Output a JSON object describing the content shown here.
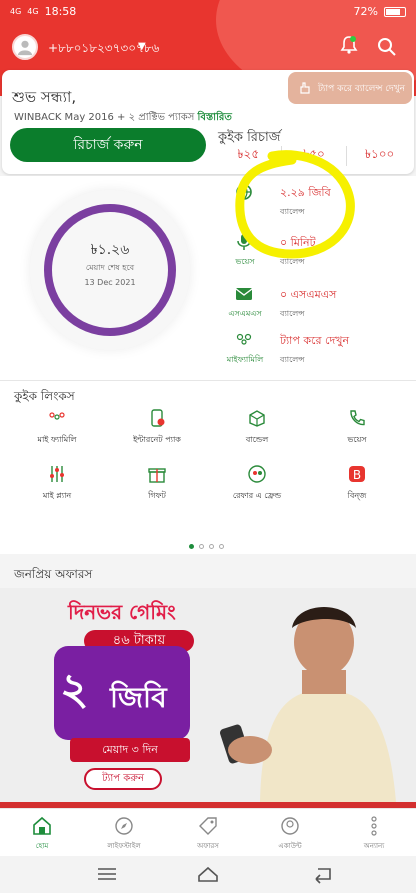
{
  "status_bar": {
    "network1": "4G",
    "network2": "4G",
    "time": "18:58",
    "battery": "72%"
  },
  "header": {
    "phone": "+৮৮০১৮২৩৭৩০৭৮৬"
  },
  "greeting": {
    "text": "শুভ সন্ধ্যা,",
    "pack": "WINBACK May 2016 + ২ প্রাক্টিভ প্যাকস",
    "details_link": "বিস্তারিত",
    "recharge_button": "রিচার্জ করুন",
    "tap_badge": "ট্যাপ করে ব্যালেন্স দেখুন"
  },
  "quick_recharge": {
    "title": "কুইক রিচার্জ",
    "amounts": [
      "৳২৫",
      "৳৫০",
      "৳১০০"
    ]
  },
  "balance": {
    "amount": "৳১.২৬",
    "expiry_label": "মেয়াদ শেষ হবে",
    "expiry_date": "13 Dec 2021",
    "internet_value": "২.২৯ জিবি",
    "internet_sub": "ব্যালেন্স",
    "voice_label": "ভয়েস",
    "voice_value": "০ মিনিট",
    "voice_sub": "ব্যালেন্স",
    "sms_label": "এসএমএস",
    "sms_value": "০ এসএমএস",
    "sms_sub": "ব্যালেন্স",
    "myfamily_label": "মাইফ্যামিলি",
    "myfamily_value": "ট্যাপ করে দেখুন",
    "myfamily_sub": "ব্যালেন্স"
  },
  "quick_links": {
    "title": "কুইক লিংকস",
    "items": [
      {
        "label": "মাই ফ্যামিলি",
        "icon": "family-icon"
      },
      {
        "label": "ইন্টারনেট প্যাক",
        "icon": "internet-pack-icon"
      },
      {
        "label": "বান্ডেল",
        "icon": "bundle-icon"
      },
      {
        "label": "ভয়েস",
        "icon": "phone-icon"
      },
      {
        "label": "মাই প্ল্যান",
        "icon": "sliders-icon"
      },
      {
        "label": "গিফট",
        "icon": "gift-icon"
      },
      {
        "label": "রেফার এ ফ্রেন্ড",
        "icon": "refer-icon"
      },
      {
        "label": "বিন্জ",
        "icon": "bioscope-icon"
      }
    ]
  },
  "offers": {
    "title": "জনপ্রিয় অফারস",
    "banner_line1": "দিনভর গেমিং",
    "banner_price": "৪৬ টাকায়",
    "banner_big": "২",
    "banner_gb": "জিবি",
    "banner_validity": "মেয়াদ ৩ দিন",
    "banner_button": "ট্যাপ করুন"
  },
  "bottom_nav": [
    {
      "label": "হোম",
      "icon": "home-icon"
    },
    {
      "label": "লাইফস্টাইল",
      "icon": "compass-icon"
    },
    {
      "label": "অফারস",
      "icon": "tag-icon"
    },
    {
      "label": "একাউন্ট",
      "icon": "account-icon"
    },
    {
      "label": "অন্যান্য",
      "icon": "more-icon"
    }
  ],
  "colors": {
    "brand_red": "#e8352f",
    "green": "#0b7d2c",
    "purple": "#7b3fa0",
    "highlight": "#f6f000"
  }
}
